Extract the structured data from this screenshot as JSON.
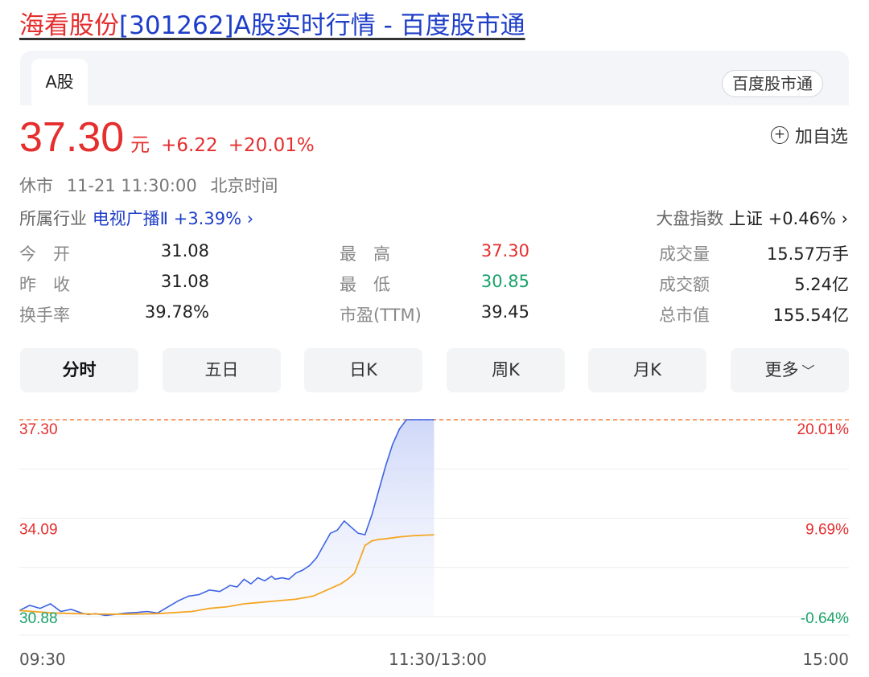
{
  "page": {
    "title_stock": "海看股份",
    "title_rest": "[301262]A股实时行情 - 百度股市通"
  },
  "header": {
    "tab": "A股",
    "source": "百度股市通"
  },
  "quote": {
    "price": "37.30",
    "unit": "元",
    "change": "+6.22",
    "change_pct": "+20.01%",
    "add_watch": "加自选"
  },
  "status": {
    "state": "休市",
    "time": "11-21 11:30:00",
    "zone": "北京时间"
  },
  "industry": {
    "label": "所属行业",
    "name": "电视广播Ⅱ",
    "change": "+3.39%"
  },
  "index": {
    "label": "大盘指数",
    "name": "上证",
    "change": "+0.46%"
  },
  "stats": [
    [
      {
        "label": "今　开",
        "value": "31.08",
        "color": "#222222"
      },
      {
        "label": "最　高",
        "value": "37.30",
        "color": "#e52e2e"
      },
      {
        "label": "成交量",
        "value": "15.57万手",
        "color": "#222222"
      }
    ],
    [
      {
        "label": "昨　收",
        "value": "31.08",
        "color": "#222222"
      },
      {
        "label": "最　低",
        "value": "30.85",
        "color": "#1aa36a"
      },
      {
        "label": "成交额",
        "value": "5.24亿",
        "color": "#222222"
      }
    ],
    [
      {
        "label": "换手率",
        "value": "39.78%",
        "color": "#222222"
      },
      {
        "label": "市盈(TTM)",
        "value": "39.45",
        "color": "#222222"
      },
      {
        "label": "总市值",
        "value": "155.54亿",
        "color": "#222222"
      }
    ]
  ],
  "period_tabs": [
    "分时",
    "五日",
    "日K",
    "周K",
    "月K",
    "更多"
  ],
  "colors": {
    "up": "#e52e2e",
    "down": "#1aa36a",
    "price_line": "#3d64e3",
    "avg_line": "#f5a623",
    "link_blue": "#1f3ec8"
  },
  "chart_data": {
    "type": "line",
    "y_left_ticks": [
      "37.30",
      "34.09",
      "30.88"
    ],
    "y_right_ticks": [
      "20.01%",
      "9.69%",
      "-0.64%"
    ],
    "x_ticks": [
      "09:30",
      "11:30/13:00",
      "15:00"
    ],
    "ylim": [
      30.88,
      37.3
    ],
    "prev_close": 31.08,
    "limit_up": 37.3,
    "series": [
      {
        "x": [
          0,
          3,
          6,
          9,
          12,
          15,
          18,
          20,
          22,
          25,
          28,
          31,
          34,
          37,
          40,
          43,
          46,
          49,
          52,
          55,
          58,
          61,
          63,
          65,
          67,
          69,
          71,
          73,
          74,
          76,
          78,
          80,
          82,
          84,
          86,
          88,
          90,
          92,
          94,
          96,
          98,
          100,
          102,
          104,
          106,
          108,
          110,
          112,
          114,
          116,
          118,
          120
        ],
        "values": [
          31.08,
          31.25,
          31.15,
          31.3,
          31.05,
          31.12,
          31.0,
          30.95,
          30.98,
          30.92,
          30.96,
          31.0,
          31.02,
          31.05,
          31.0,
          31.2,
          31.4,
          31.55,
          31.6,
          31.75,
          31.7,
          31.9,
          31.85,
          32.1,
          31.95,
          32.15,
          32.05,
          32.2,
          32.1,
          32.15,
          32.1,
          32.3,
          32.4,
          32.55,
          32.8,
          33.2,
          33.6,
          33.7,
          34.0,
          33.8,
          33.6,
          33.55,
          34.2,
          35.0,
          35.8,
          36.5,
          37.0,
          37.3,
          37.3,
          37.3,
          37.3,
          37.3
        ]
      },
      {
        "x": [
          0,
          10,
          20,
          30,
          40,
          50,
          55,
          60,
          65,
          70,
          75,
          80,
          85,
          90,
          93,
          95,
          97,
          99,
          100,
          102,
          104,
          106,
          108,
          110,
          112,
          114,
          116,
          118,
          120
        ],
        "values": [
          31.08,
          31.0,
          30.97,
          30.96,
          30.98,
          31.05,
          31.15,
          31.2,
          31.3,
          31.35,
          31.4,
          31.45,
          31.55,
          31.8,
          31.95,
          32.1,
          32.3,
          32.9,
          33.2,
          33.35,
          33.4,
          33.42,
          33.45,
          33.48,
          33.5,
          33.52,
          33.53,
          33.54,
          33.55
        ]
      }
    ]
  }
}
